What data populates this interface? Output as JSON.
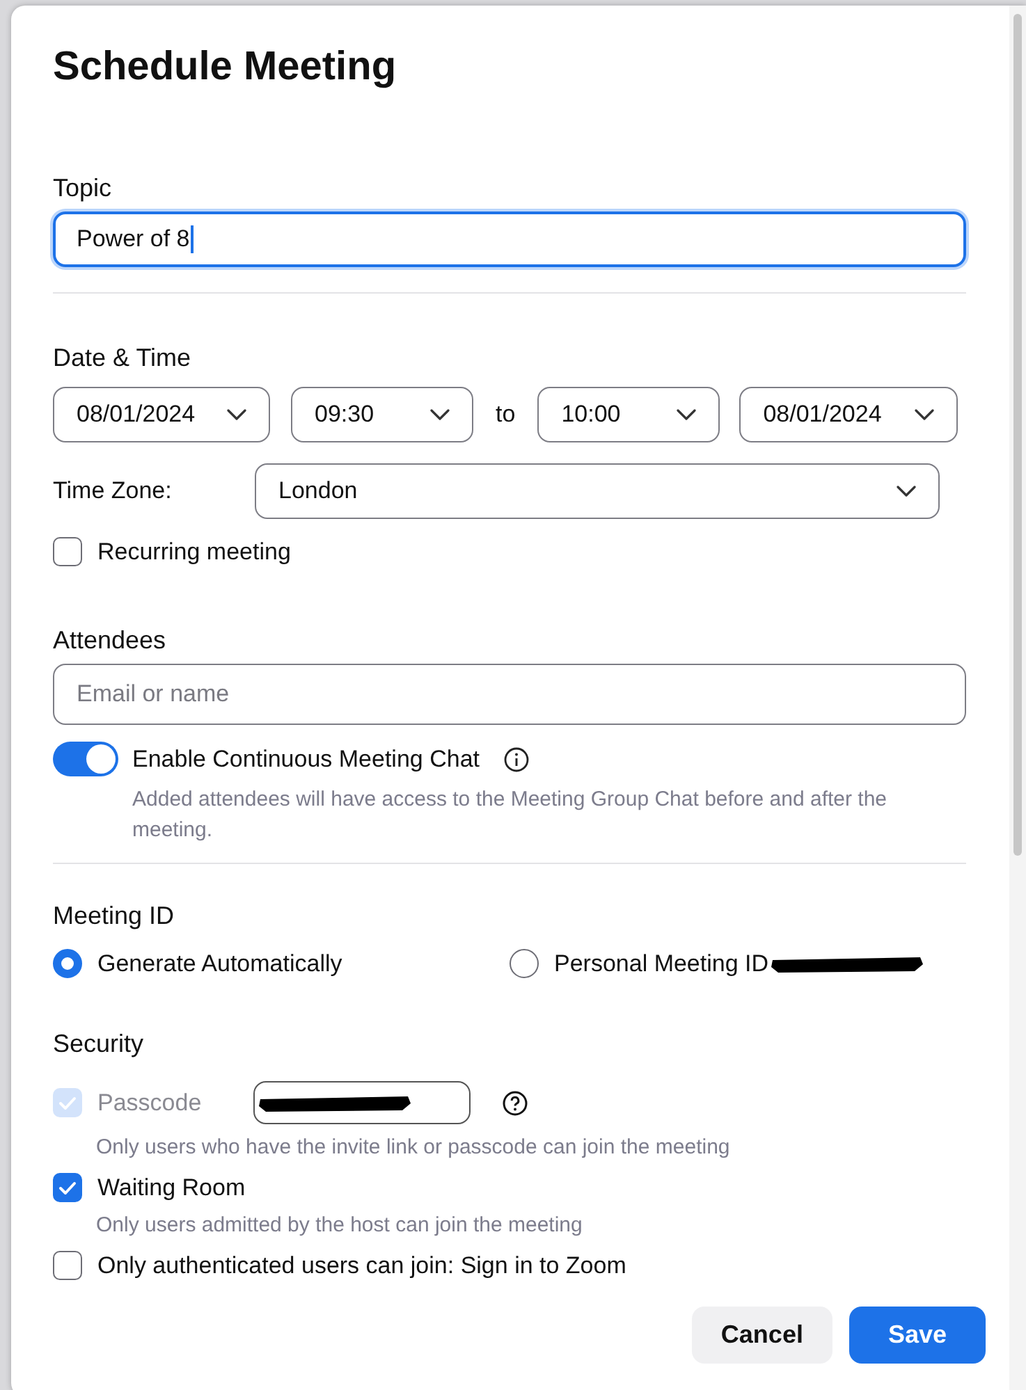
{
  "dialog": {
    "title": "Schedule Meeting"
  },
  "topic": {
    "label": "Topic",
    "value": "Power of 8",
    "focused": true
  },
  "date_time": {
    "label": "Date & Time",
    "start_date": "08/01/2024",
    "start_time": "09:30",
    "separator": "to",
    "end_time": "10:00",
    "end_date": "08/01/2024",
    "time_zone_label": "Time Zone:",
    "time_zone": "London",
    "recurring": {
      "label": "Recurring meeting",
      "checked": false
    }
  },
  "attendees": {
    "label": "Attendees",
    "placeholder": "Email or name",
    "chat_toggle": {
      "label": "Enable Continuous Meeting Chat",
      "on": true
    },
    "chat_note": "Added attendees will have access to the Meeting Group Chat before and after the meeting."
  },
  "meeting_id": {
    "label": "Meeting ID",
    "options": [
      {
        "label": "Generate Automatically",
        "selected": true,
        "kind": "plain"
      },
      {
        "label": "Personal Meeting ID",
        "selected": false,
        "kind": "redacted"
      }
    ]
  },
  "security": {
    "label": "Security",
    "options": [
      {
        "label": "Passcode",
        "checked": true,
        "disabled": true,
        "kind": "passcode",
        "note": "Only users who have the invite link or passcode can join the meeting"
      },
      {
        "label": "Waiting Room",
        "checked": true,
        "disabled": false,
        "kind": "plain",
        "note": "Only users admitted by the host can join the meeting"
      },
      {
        "label": "Only authenticated users can join: Sign in to Zoom",
        "checked": false,
        "disabled": false,
        "kind": "plain"
      }
    ]
  },
  "buttons": [
    {
      "label": "Cancel",
      "kind": "secondary"
    },
    {
      "label": "Save",
      "kind": "primary"
    }
  ]
}
